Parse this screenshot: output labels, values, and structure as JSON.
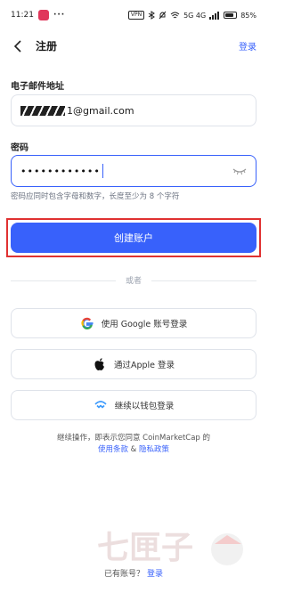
{
  "status_bar": {
    "time": "11:21",
    "dots": "···",
    "indicators": [
      "VPN",
      "bluetooth-icon",
      "mute-icon",
      "wifi-icon",
      "5G",
      "signal-icon",
      "4G"
    ],
    "vpn_label": "VPN",
    "network_label": "5G 4G",
    "battery_text": "85%",
    "battery_level": 0.85
  },
  "nav": {
    "title": "注册",
    "login_link": "登录"
  },
  "email": {
    "label": "电子邮件地址",
    "value_visible": "1@gmail.com"
  },
  "password": {
    "label": "密码",
    "value_masked": "••••••••••••",
    "hint": "密码应同时包含字母和数字，长度至少为 8 个字符"
  },
  "create_button": {
    "label": "创建账户"
  },
  "divider": {
    "text": "或者"
  },
  "social": [
    {
      "label": "使用 Google 账号登录",
      "icon": "google-icon"
    },
    {
      "label": "通过Apple 登录",
      "icon": "apple-icon"
    },
    {
      "label": "继续以钱包登录",
      "icon": "wallet-connect-icon"
    }
  ],
  "terms": {
    "prefix": "继续操作，即表示您同意 CoinMarketCap 的",
    "terms_link": "使用条款",
    "and": "&",
    "privacy_link": "隐私政策"
  },
  "footer": {
    "question": "已有账号？",
    "login_link": "登录"
  },
  "watermark": {
    "text": "七匣子"
  },
  "colors": {
    "accent": "#3861fb",
    "highlight_frame": "#e03131",
    "border": "#dfe3ea"
  }
}
